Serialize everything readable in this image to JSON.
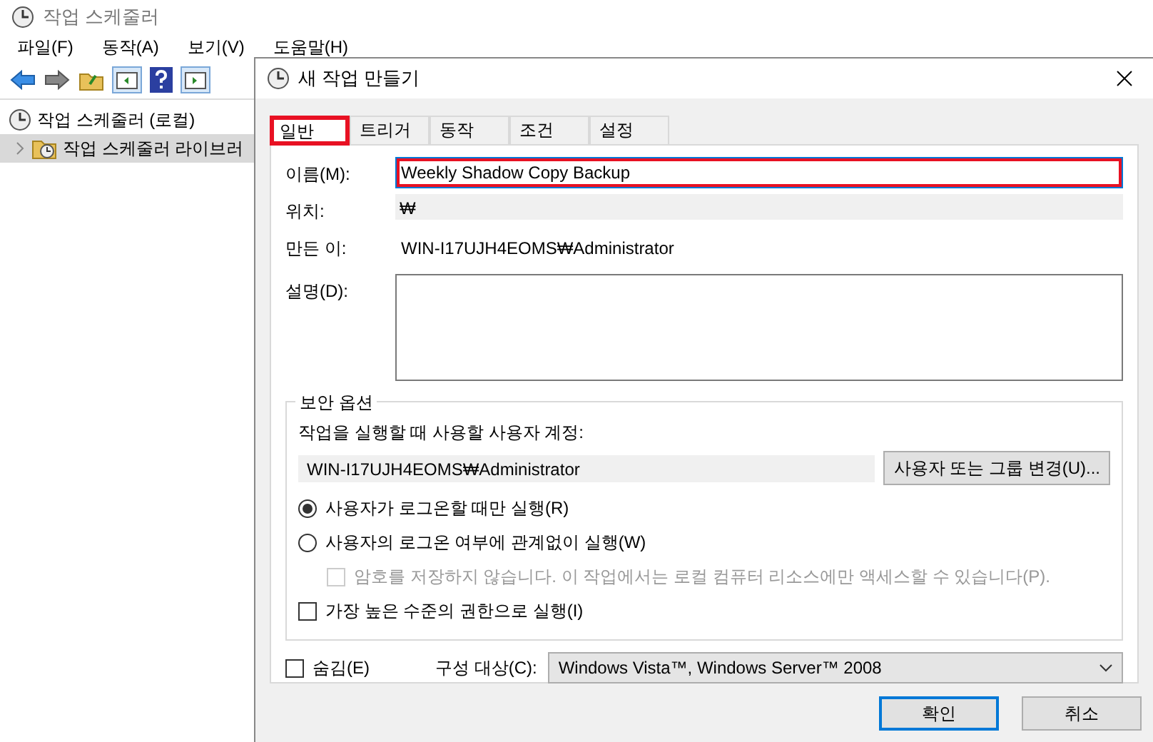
{
  "app": {
    "title": "작업 스케줄러",
    "menu": [
      "파일(F)",
      "동작(A)",
      "보기(V)",
      "도움말(H)"
    ],
    "tree": [
      {
        "label": "작업 스케줄러 (로컬)",
        "selected": false,
        "children": [
          {
            "label": "작업 스케줄러 라이브러",
            "selected": true
          }
        ]
      }
    ]
  },
  "dialog": {
    "title": "새 작업 만들기",
    "tabs": [
      {
        "label": "일반",
        "selected": true,
        "highlighted": true
      },
      {
        "label": "트리거",
        "selected": false,
        "highlighted": false
      },
      {
        "label": "동작",
        "selected": false,
        "highlighted": false
      },
      {
        "label": "조건",
        "selected": false,
        "highlighted": false
      },
      {
        "label": "설정",
        "selected": false,
        "highlighted": false
      }
    ],
    "fields": [
      {
        "label": "이름(M):",
        "kind": "input",
        "value": "Weekly Shadow Copy Backup",
        "highlighted": true
      },
      {
        "label": "위치:",
        "kind": "readonly",
        "value": "₩"
      },
      {
        "label": "만든 이:",
        "kind": "text",
        "value": "WIN-I17UJH4EOMS₩Administrator"
      },
      {
        "label": "설명(D):",
        "kind": "textarea"
      }
    ],
    "security": {
      "title": "보안 옵션",
      "account_label": "작업을 실행할 때 사용할 사용자 계정:",
      "account": "WIN-I17UJH4EOMS₩Administrator",
      "change_button": "사용자 또는 그룹 변경(U)...",
      "options": [
        {
          "kind": "radio",
          "label": "사용자가 로그온할 때만 실행(R)",
          "checked": true,
          "disabled": false
        },
        {
          "kind": "radio",
          "label": "사용자의 로그온 여부에 관계없이 실행(W)",
          "checked": false,
          "disabled": false,
          "children": [
            {
              "kind": "checkbox",
              "label": "암호를 저장하지 않습니다. 이 작업에서는 로컬 컴퓨터 리소스에만 액세스할 수 있습니다(P).",
              "checked": false,
              "disabled": true
            }
          ]
        },
        {
          "kind": "checkbox",
          "label": "가장 높은 수준의 권한으로 실행(I)",
          "checked": false,
          "disabled": false
        }
      ]
    },
    "hidden": {
      "label": "숨김(E)",
      "checked": false
    },
    "configure": {
      "label": "구성 대상(C):",
      "value": "Windows Vista™, Windows Server™ 2008"
    },
    "buttons": [
      {
        "label": "확인",
        "default": true
      },
      {
        "label": "취소",
        "default": false
      }
    ]
  }
}
